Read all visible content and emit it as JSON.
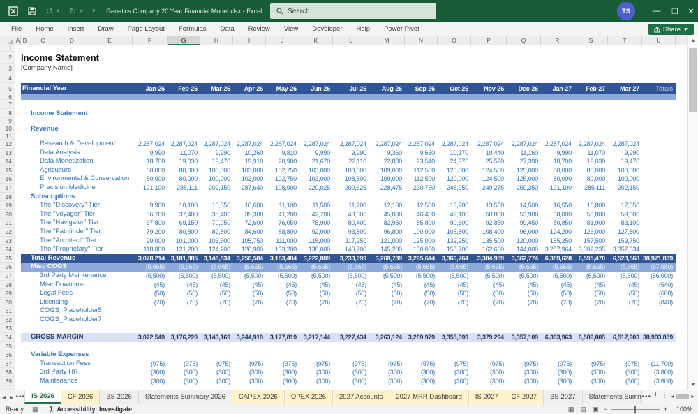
{
  "title_bar": {
    "app_title": "Genetics Company 20 Year Financial Model.xlsx  -  Excel",
    "search_placeholder": "Search",
    "avatar_initials": "TS"
  },
  "ribbon": {
    "tabs": [
      "File",
      "Home",
      "Insert",
      "Draw",
      "Page Layout",
      "Formulas",
      "Data",
      "Review",
      "View",
      "Developer",
      "Help",
      "Power Pivot"
    ],
    "share_label": "Share"
  },
  "colors": {
    "titlebar_green": "#185C37",
    "band_dark_blue": "#2F5597",
    "band_mid_blue": "#8EAADB",
    "band_light_blue": "#D9E1F2",
    "cell_text_blue": "#2E75B6",
    "gross_margin_navy": "#1F3864",
    "sheet_tab_yellow": "#FEF2CB",
    "active_tab_green": "#217346"
  },
  "grid": {
    "column_letters": [
      "A",
      "B",
      "C",
      "D",
      "E",
      "F",
      "G",
      "H",
      "I",
      "J",
      "K",
      "L",
      "M",
      "N",
      "O",
      "P",
      "Q",
      "R",
      "S",
      "T",
      "U"
    ],
    "selected_column": "G",
    "sheet_title": "Income Statement",
    "sheet_subtitle": "[Company Name]",
    "header": {
      "label": "Financial Year",
      "months": [
        "Jan-26",
        "Feb-26",
        "Mar-26",
        "Apr-26",
        "May-26",
        "Jun-26",
        "Jul-26",
        "Aug-26",
        "Sep-26",
        "Oct-26",
        "Nov-26",
        "Dec-26",
        "Jan-27",
        "Feb-27",
        "Mar-27"
      ],
      "totals_label": "Totals"
    },
    "rows": [
      {
        "n": 2,
        "style": "sheet-title",
        "label": "Income Statement"
      },
      {
        "n": 3,
        "style": "subtitle",
        "label": "[Company Name]"
      },
      {
        "n": 5,
        "style": "month-header"
      },
      {
        "n": 6,
        "style": "band-light-empty"
      },
      {
        "n": 8,
        "style": "section",
        "label": "Income Statement"
      },
      {
        "n": 10,
        "style": "section",
        "label": "Revenue"
      },
      {
        "n": 12,
        "style": "item",
        "label": "Research & Development",
        "fill": "2,287,024",
        "total": ""
      },
      {
        "n": 13,
        "style": "item",
        "label": "Data Analysis",
        "values": [
          "9,990",
          "11,070",
          "9,990",
          "10,260",
          "9,810",
          "9,990",
          "9,990",
          "9,360",
          "9,630",
          "10,170",
          "10,440",
          "11,160",
          "9,990",
          "11,070",
          "9,990"
        ],
        "total": ""
      },
      {
        "n": 14,
        "style": "item",
        "label": "Data Monetization",
        "values": [
          "18,700",
          "19,030",
          "19,470",
          "19,910",
          "20,900",
          "21,670",
          "22,110",
          "22,880",
          "23,540",
          "24,970",
          "25,520",
          "27,390",
          "18,700",
          "19,030",
          "19,470"
        ],
        "total": ""
      },
      {
        "n": 15,
        "style": "item",
        "label": "Agriculture",
        "values": [
          "80,000",
          "80,000",
          "100,000",
          "103,000",
          "102,750",
          "103,000",
          "108,500",
          "109,000",
          "112,500",
          "120,000",
          "124,500",
          "125,000",
          "80,000",
          "80,000",
          "100,000"
        ],
        "total": ""
      },
      {
        "n": 16,
        "style": "item",
        "label": "Environmental & Conservation",
        "values": [
          "80,000",
          "80,000",
          "100,000",
          "103,000",
          "102,750",
          "103,000",
          "108,500",
          "109,000",
          "112,500",
          "120,000",
          "124,500",
          "125,000",
          "80,000",
          "80,000",
          "100,000"
        ],
        "total": ""
      },
      {
        "n": 17,
        "style": "item",
        "label": "Precision Medicine",
        "values": [
          "191,100",
          "285,111",
          "202,150",
          "287,640",
          "198,900",
          "220,025",
          "209,625",
          "228,475",
          "230,750",
          "248,950",
          "249,275",
          "259,350",
          "191,100",
          "285,111",
          "202,150"
        ],
        "total": ""
      },
      {
        "n": 18,
        "style": "section",
        "label": "Subscriptions"
      },
      {
        "n": 19,
        "style": "item",
        "label": "The \"Discovery\" Tier",
        "values": [
          "9,900",
          "10,100",
          "10,350",
          "10,600",
          "11,100",
          "11,500",
          "11,700",
          "12,100",
          "12,500",
          "13,200",
          "13,550",
          "14,500",
          "16,550",
          "16,800",
          "17,050"
        ],
        "total": ""
      },
      {
        "n": 20,
        "style": "item",
        "label": "The \"Voyager\" Tier",
        "values": [
          "36,700",
          "37,400",
          "38,400",
          "39,300",
          "41,200",
          "42,700",
          "43,500",
          "45,000",
          "46,400",
          "49,100",
          "50,800",
          "53,900",
          "58,000",
          "58,800",
          "59,600"
        ],
        "total": ""
      },
      {
        "n": 21,
        "style": "item",
        "label": "The \"Navigator\" Tier",
        "values": [
          "67,800",
          "69,150",
          "70,950",
          "72,600",
          "76,050",
          "78,900",
          "80,400",
          "82,950",
          "85,800",
          "90,600",
          "92,850",
          "99,450",
          "80,850",
          "81,900",
          "83,100"
        ],
        "total": ""
      },
      {
        "n": 22,
        "style": "item",
        "label": "The \"Pathfinder\" Tier",
        "values": [
          "79,200",
          "80,800",
          "82,800",
          "84,600",
          "88,800",
          "92,000",
          "93,800",
          "96,800",
          "100,000",
          "105,800",
          "108,400",
          "96,000",
          "124,200",
          "126,000",
          "127,800"
        ],
        "total": ""
      },
      {
        "n": 23,
        "style": "item",
        "label": "The \"Architect\" Tier",
        "values": [
          "99,000",
          "101,000",
          "103,500",
          "105,750",
          "111,000",
          "115,000",
          "117,250",
          "121,000",
          "125,000",
          "132,250",
          "135,500",
          "120,000",
          "155,250",
          "157,500",
          "159,750"
        ],
        "total": ""
      },
      {
        "n": 24,
        "style": "item",
        "label": "The \"Proprietary\" Tier",
        "values": [
          "118,800",
          "121,200",
          "124,200",
          "126,900",
          "133,200",
          "138,000",
          "140,700",
          "145,200",
          "150,000",
          "158,700",
          "162,600",
          "144,000",
          "3,287,964",
          "3,392,235",
          "3,357,634"
        ],
        "total": ""
      },
      {
        "n": 25,
        "style": "total-dark",
        "label": "Total Revenue",
        "values": [
          "3,078,214",
          "3,181,885",
          "3,148,834",
          "3,250,584",
          "3,183,484",
          "3,222,809",
          "3,233,099",
          "3,268,789",
          "3,295,644",
          "3,360,764",
          "3,384,959",
          "3,362,774",
          "6,389,628",
          "6,595,470",
          "6,523,568"
        ],
        "total": "38,971,839"
      },
      {
        "n": 26,
        "style": "band-mid",
        "label": "Misc COGS",
        "fill": "(5,665)",
        "total": "(67,980)"
      },
      {
        "n": 27,
        "style": "item",
        "label": "3rd Party Maintenance",
        "fill": "(5,500)",
        "total": "(66,000)"
      },
      {
        "n": 28,
        "style": "item",
        "label": "Misc Downtime",
        "fill": "(45)",
        "total": "(540)"
      },
      {
        "n": 29,
        "style": "item",
        "label": "Legal Fees",
        "fill": "(50)",
        "total": "(600)"
      },
      {
        "n": 30,
        "style": "item",
        "label": "Licensing",
        "fill": "(70)",
        "total": "(840)"
      },
      {
        "n": 31,
        "style": "item",
        "label": "COGS_Placeholder5",
        "fill": "-",
        "total": "-"
      },
      {
        "n": 32,
        "style": "item",
        "label": "COGS_Placeholder7",
        "fill": "-",
        "total": "-"
      },
      {
        "n": 34,
        "style": "total-light",
        "label": "GROSS MARGIN",
        "values": [
          "3,072,549",
          "3,176,220",
          "3,143,169",
          "3,244,919",
          "3,177,819",
          "3,217,144",
          "3,227,434",
          "3,263,124",
          "3,289,979",
          "3,355,099",
          "3,379,294",
          "3,357,109",
          "6,383,963",
          "6,589,805",
          "6,517,903"
        ],
        "total": "38,903,859"
      },
      {
        "n": 36,
        "style": "section",
        "label": "Variable Expenses"
      },
      {
        "n": 37,
        "style": "item",
        "label": "Transaction Fees",
        "fill": "(975)",
        "total": "(11,700)"
      },
      {
        "n": 38,
        "style": "item",
        "label": "3rd Party HR",
        "fill": "(300)",
        "total": "(3,600)"
      },
      {
        "n": 39,
        "style": "item",
        "label": "Maintenance",
        "fill": "(300)",
        "total": "(3,600)"
      }
    ]
  },
  "sheet_tabs": [
    {
      "label": "IS 2026",
      "state": "active"
    },
    {
      "label": "CF 2026",
      "color": "yellow"
    },
    {
      "label": "BS 2026"
    },
    {
      "label": "Statements Summary 2026"
    },
    {
      "label": "CAPEX 2026",
      "color": "yellow"
    },
    {
      "label": "OPEX 2026",
      "color": "yellow"
    },
    {
      "label": "2027 Accounts",
      "color": "yellow"
    },
    {
      "label": "2027 MRR Dashboard",
      "color": "yellow"
    },
    {
      "label": "IS 2027",
      "color": "yellow"
    },
    {
      "label": "CF 2027",
      "color": "yellow"
    },
    {
      "label": "BS 2027"
    },
    {
      "label": "Statements Summ",
      "clipped": true
    }
  ],
  "status_bar": {
    "ready": "Ready",
    "accessibility": "Accessibility: Investigate",
    "zoom": "100%"
  }
}
